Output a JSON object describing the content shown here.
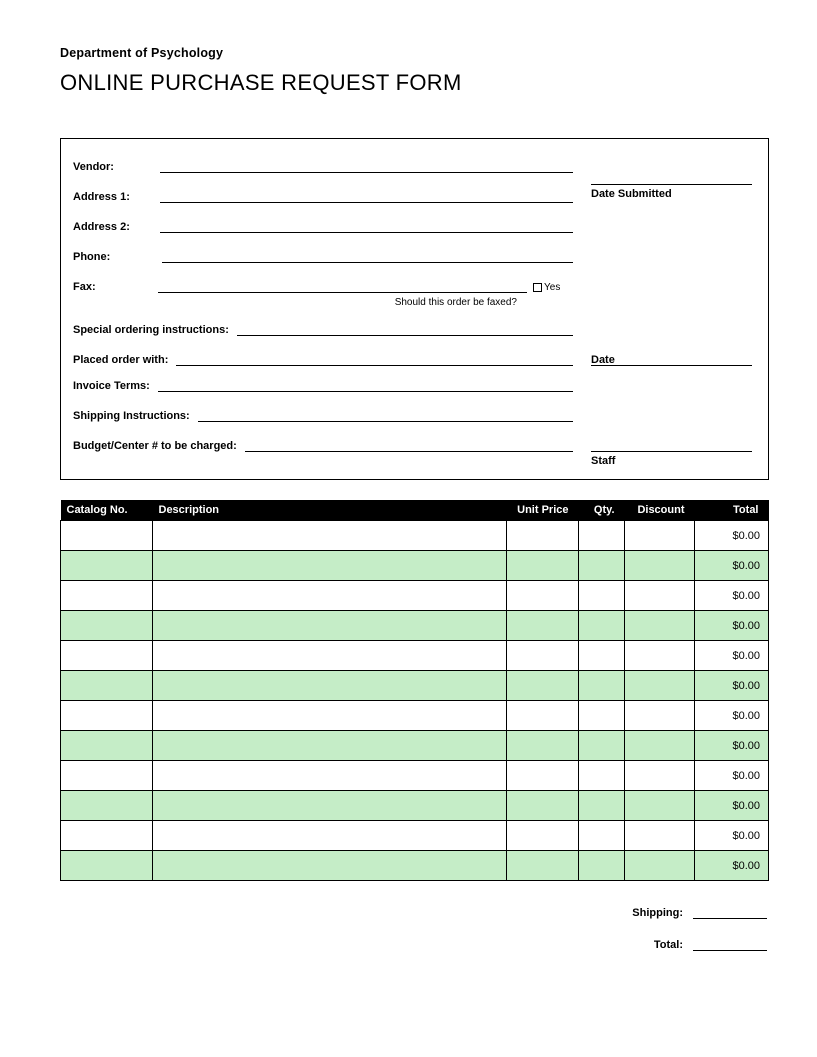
{
  "header": {
    "department": "Department of Psychology",
    "title": "ONLINE PURCHASE REQUEST FORM"
  },
  "form": {
    "vendor_label": "Vendor:",
    "address1_label": "Address 1:",
    "address2_label": "Address 2:",
    "phone_label": "Phone:",
    "fax_label": "Fax:",
    "fax_yes_label": "Yes",
    "fax_hint": "Should this order be faxed?",
    "special_instructions_label": "Special ordering instructions:",
    "placed_with_label": "Placed order with:",
    "invoice_terms_label": "Invoice Terms:",
    "shipping_instructions_label": "Shipping Instructions:",
    "budget_label": "Budget/Center # to be charged:",
    "date_submitted_label": "Date Submitted",
    "date_label": "Date",
    "staff_label": "Staff"
  },
  "table": {
    "headers": {
      "catalog": "Catalog No.",
      "description": "Description",
      "unit_price": "Unit Price",
      "qty": "Qty.",
      "discount": "Discount",
      "total": "Total"
    },
    "rows": [
      {
        "catalog": "",
        "description": "",
        "unit_price": "",
        "qty": "",
        "discount": "",
        "total": "$0.00"
      },
      {
        "catalog": "",
        "description": "",
        "unit_price": "",
        "qty": "",
        "discount": "",
        "total": "$0.00"
      },
      {
        "catalog": "",
        "description": "",
        "unit_price": "",
        "qty": "",
        "discount": "",
        "total": "$0.00"
      },
      {
        "catalog": "",
        "description": "",
        "unit_price": "",
        "qty": "",
        "discount": "",
        "total": "$0.00"
      },
      {
        "catalog": "",
        "description": "",
        "unit_price": "",
        "qty": "",
        "discount": "",
        "total": "$0.00"
      },
      {
        "catalog": "",
        "description": "",
        "unit_price": "",
        "qty": "",
        "discount": "",
        "total": "$0.00"
      },
      {
        "catalog": "",
        "description": "",
        "unit_price": "",
        "qty": "",
        "discount": "",
        "total": "$0.00"
      },
      {
        "catalog": "",
        "description": "",
        "unit_price": "",
        "qty": "",
        "discount": "",
        "total": "$0.00"
      },
      {
        "catalog": "",
        "description": "",
        "unit_price": "",
        "qty": "",
        "discount": "",
        "total": "$0.00"
      },
      {
        "catalog": "",
        "description": "",
        "unit_price": "",
        "qty": "",
        "discount": "",
        "total": "$0.00"
      },
      {
        "catalog": "",
        "description": "",
        "unit_price": "",
        "qty": "",
        "discount": "",
        "total": "$0.00"
      },
      {
        "catalog": "",
        "description": "",
        "unit_price": "",
        "qty": "",
        "discount": "",
        "total": "$0.00"
      }
    ]
  },
  "totals": {
    "shipping_label": "Shipping:",
    "total_label": "Total:",
    "shipping_value": "",
    "total_value": ""
  }
}
